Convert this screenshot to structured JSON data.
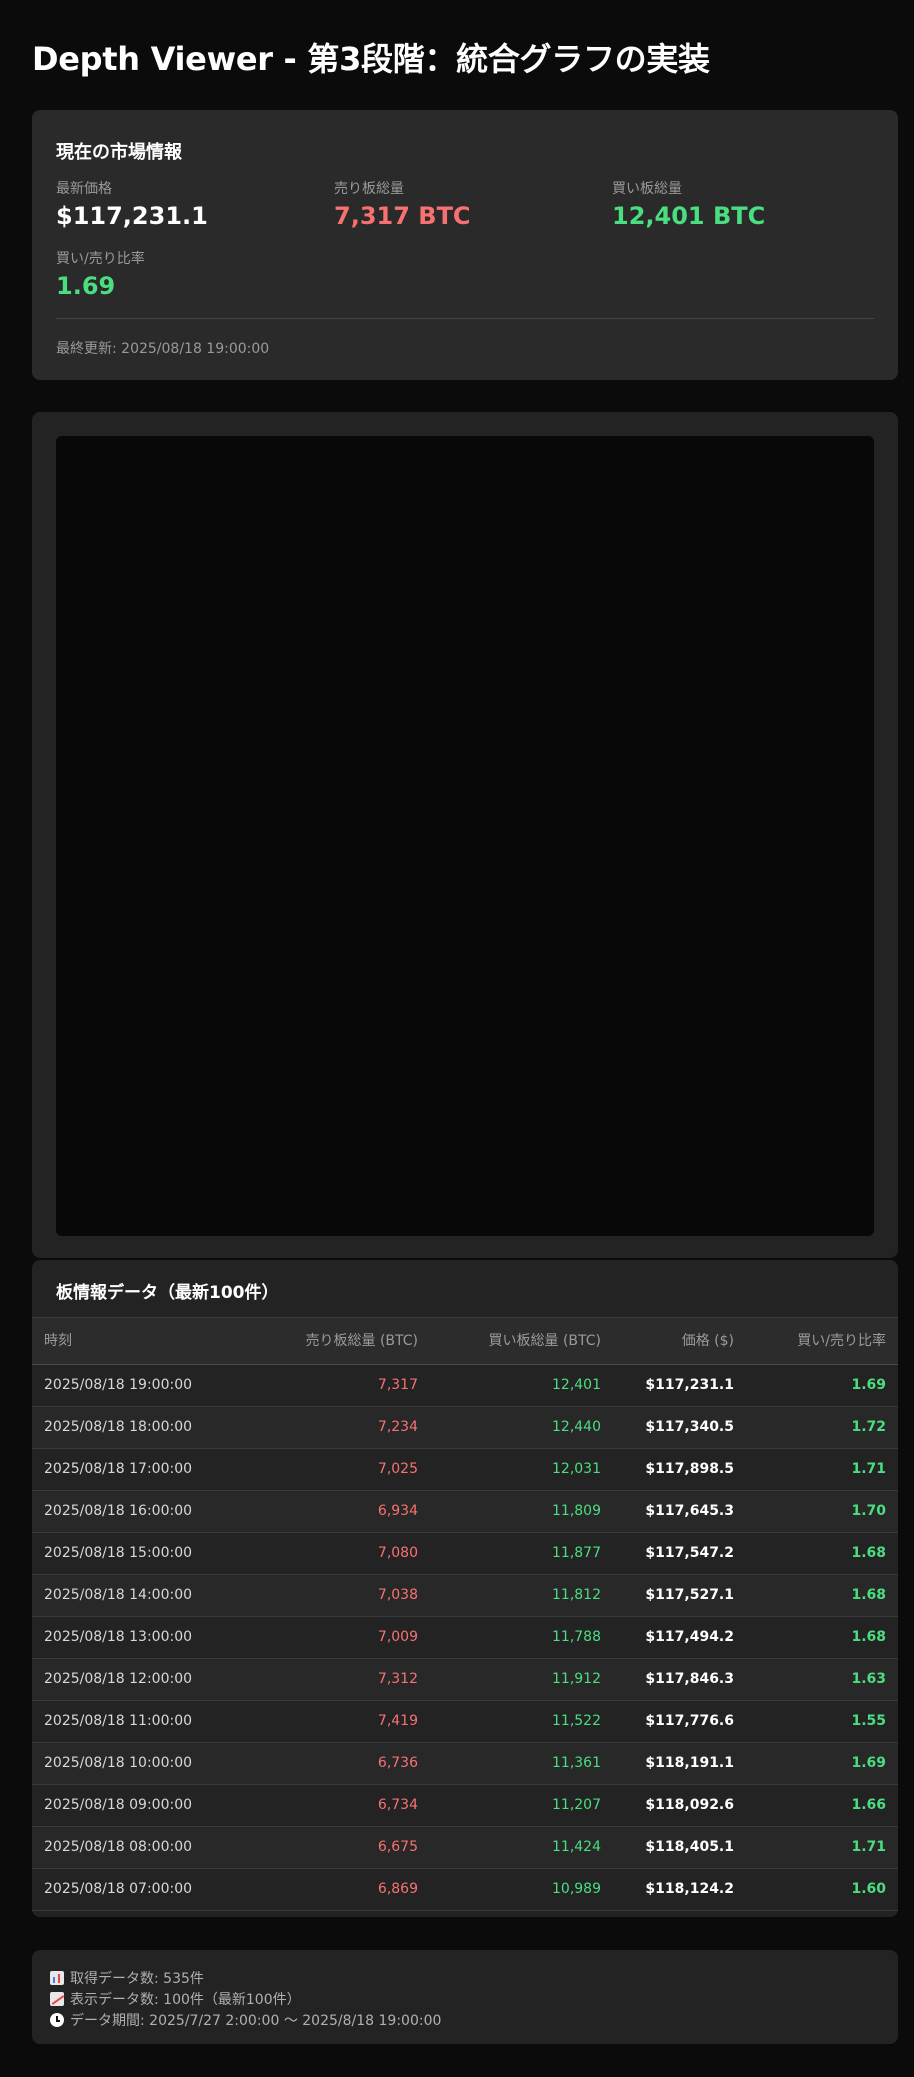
{
  "page": {
    "title": "Depth Viewer - 第3段階：統合グラフの実装"
  },
  "market": {
    "heading": "現在の市場情報",
    "latest_price_label": "最新価格",
    "latest_price_value": "$117,231.1",
    "sell_total_label": "売り板総量",
    "sell_total_value": "7,317 BTC",
    "buy_total_label": "買い板総量",
    "buy_total_value": "12,401 BTC",
    "ratio_label": "買い/売り比率",
    "ratio_value": "1.69",
    "last_updated": "最終更新: 2025/08/18 19:00:00"
  },
  "table": {
    "heading": "板情報データ（最新100件）",
    "columns": [
      "時刻",
      "売り板総量 (BTC)",
      "買い板総量 (BTC)",
      "価格 ($)",
      "買い/売り比率"
    ],
    "rows": [
      [
        "2025/08/18 19:00:00",
        "7,317",
        "12,401",
        "$117,231.1",
        "1.69"
      ],
      [
        "2025/08/18 18:00:00",
        "7,234",
        "12,440",
        "$117,340.5",
        "1.72"
      ],
      [
        "2025/08/18 17:00:00",
        "7,025",
        "12,031",
        "$117,898.5",
        "1.71"
      ],
      [
        "2025/08/18 16:00:00",
        "6,934",
        "11,809",
        "$117,645.3",
        "1.70"
      ],
      [
        "2025/08/18 15:00:00",
        "7,080",
        "11,877",
        "$117,547.2",
        "1.68"
      ],
      [
        "2025/08/18 14:00:00",
        "7,038",
        "11,812",
        "$117,527.1",
        "1.68"
      ],
      [
        "2025/08/18 13:00:00",
        "7,009",
        "11,788",
        "$117,494.2",
        "1.68"
      ],
      [
        "2025/08/18 12:00:00",
        "7,312",
        "11,912",
        "$117,846.3",
        "1.63"
      ],
      [
        "2025/08/18 11:00:00",
        "7,419",
        "11,522",
        "$117,776.6",
        "1.55"
      ],
      [
        "2025/08/18 10:00:00",
        "6,736",
        "11,361",
        "$118,191.1",
        "1.69"
      ],
      [
        "2025/08/18 09:00:00",
        "6,734",
        "11,207",
        "$118,092.6",
        "1.66"
      ],
      [
        "2025/08/18 08:00:00",
        "6,675",
        "11,424",
        "$118,405.1",
        "1.71"
      ],
      [
        "2025/08/18 07:00:00",
        "6,869",
        "10,989",
        "$118,124.2",
        "1.60"
      ]
    ]
  },
  "info": {
    "fetched_count": "取得データ数: 535件",
    "displayed_count": "表示データ数: 100件（最新100件）",
    "period": "データ期間: 2025/7/27 2:00:00 〜 2025/8/18 19:00:00",
    "icons": [
      "bar-chart-icon",
      "chart-increasing-icon",
      "clock-icon"
    ]
  },
  "colors": {
    "sell": "#f87171",
    "buy": "#4ade80",
    "background": "#0b0b0b",
    "card": "#2a2a2a"
  }
}
